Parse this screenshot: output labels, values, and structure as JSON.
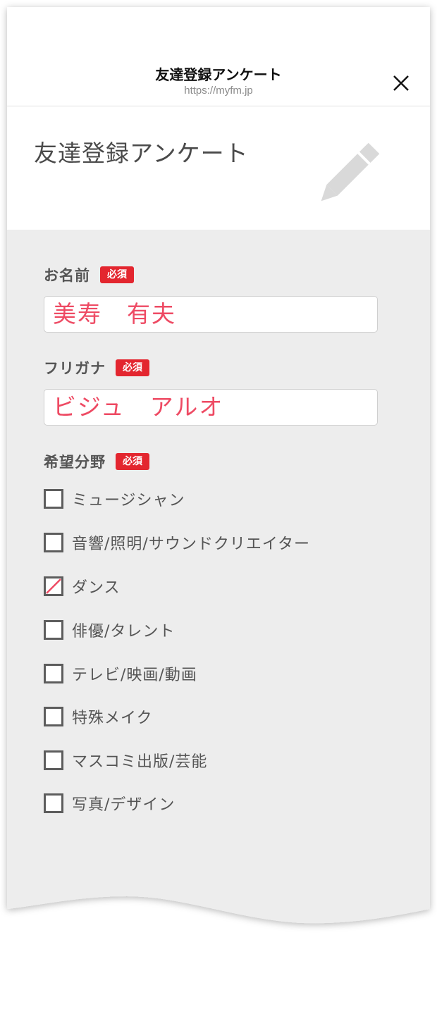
{
  "header": {
    "title": "友達登録アンケート",
    "url": "https://myfm.jp"
  },
  "banner": {
    "title": "友達登録アンケート"
  },
  "form": {
    "name": {
      "label": "お名前",
      "required": "必須",
      "value": "美寿　有夫"
    },
    "furigana": {
      "label": "フリガナ",
      "required": "必須",
      "value": "ビジュ　アルオ"
    },
    "field_of_interest": {
      "label": "希望分野",
      "required": "必須",
      "options": [
        {
          "label": "ミュージシャン",
          "checked": false
        },
        {
          "label": "音響/照明/サウンドクリエイター",
          "checked": false
        },
        {
          "label": "ダンス",
          "checked": true
        },
        {
          "label": "俳優/タレント",
          "checked": false
        },
        {
          "label": "テレビ/映画/動画",
          "checked": false
        },
        {
          "label": "特殊メイク",
          "checked": false
        },
        {
          "label": "マスコミ出版/芸能",
          "checked": false
        },
        {
          "label": "写真/デザイン",
          "checked": false
        }
      ]
    }
  },
  "colors": {
    "required_badge": "#e3262f",
    "input_text": "#ee4a63",
    "form_bg": "#ededed",
    "check_mark": "#ee4a63"
  }
}
